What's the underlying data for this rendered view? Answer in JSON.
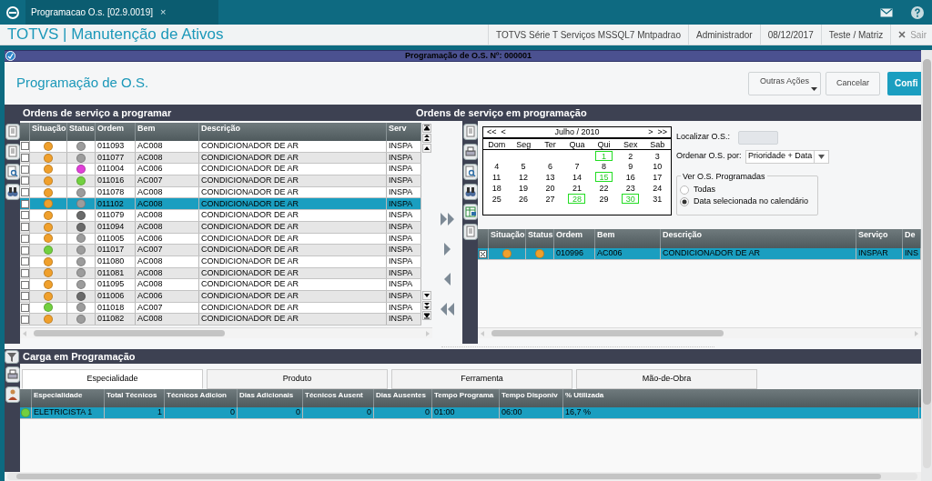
{
  "app_bar": {
    "tab": {
      "label": "Programacao O.s. [02.9.0019]",
      "close": "×"
    }
  },
  "header": {
    "title": "TOTVS | Manutenção de Ativos",
    "info": [
      "TOTVS Série T Serviços MSSQL7 Mntpadrao",
      "Administrador",
      "08/12/2017",
      "Teste / Matriz"
    ],
    "exit": "Sair"
  },
  "dialog_title": "Programação de O.S. Nº: 000001",
  "page_title": "Programação de O.S.",
  "actions": [
    {
      "label": "Outras Ações",
      "kind": "menu"
    },
    {
      "label": "Cancelar",
      "kind": "plain"
    },
    {
      "label": "Confi",
      "kind": "primary"
    }
  ],
  "left_panel": {
    "title": "Ordens de serviço a programar",
    "columns": [
      "Situação",
      "Status",
      "Ordem",
      "Bem",
      "Descrição",
      "Serv"
    ],
    "rows": [
      {
        "checked": false,
        "selected": false,
        "situacao": {
          "color": "#f0a02c"
        },
        "status": {
          "color": "#9c9c9c"
        },
        "ordem": "011093",
        "bem": "AC008",
        "descricao": "CONDICIONADOR DE AR",
        "servico": "INSPA"
      },
      {
        "checked": false,
        "selected": false,
        "situacao": {
          "color": "#f0a02c"
        },
        "status": {
          "color": "#9c9c9c"
        },
        "ordem": "011077",
        "bem": "AC008",
        "descricao": "CONDICIONADOR DE AR",
        "servico": "INSPA"
      },
      {
        "checked": false,
        "selected": false,
        "situacao": {
          "color": "#f0a02c"
        },
        "status": {
          "color": "#e040d8"
        },
        "ordem": "011004",
        "bem": "AC006",
        "descricao": "CONDICIONADOR DE AR",
        "servico": "INSPA"
      },
      {
        "checked": false,
        "selected": false,
        "situacao": {
          "color": "#f0a02c"
        },
        "status": {
          "color": "#72d040"
        },
        "ordem": "011016",
        "bem": "AC007",
        "descricao": "CONDICIONADOR DE AR",
        "servico": "INSPA"
      },
      {
        "checked": false,
        "selected": false,
        "situacao": {
          "color": "#f0a02c"
        },
        "status": {
          "color": "#9c9c9c"
        },
        "ordem": "011078",
        "bem": "AC008",
        "descricao": "CONDICIONADOR DE AR",
        "servico": "INSPA"
      },
      {
        "checked": false,
        "selected": true,
        "situacao": {
          "color": "#f0a02c"
        },
        "status": {
          "color": "#9c9c9c"
        },
        "ordem": "011102",
        "bem": "AC008",
        "descricao": "CONDICIONADOR DE AR",
        "servico": "INSPA"
      },
      {
        "checked": false,
        "selected": false,
        "situacao": {
          "color": "#f0a02c"
        },
        "status": {
          "color": "#6a6a6a"
        },
        "ordem": "011079",
        "bem": "AC008",
        "descricao": "CONDICIONADOR DE AR",
        "servico": "INSPA"
      },
      {
        "checked": false,
        "selected": false,
        "situacao": {
          "color": "#f0a02c"
        },
        "status": {
          "color": "#6a6a6a"
        },
        "ordem": "011094",
        "bem": "AC008",
        "descricao": "CONDICIONADOR DE AR",
        "servico": "INSPA"
      },
      {
        "checked": false,
        "selected": false,
        "situacao": {
          "color": "#f0a02c"
        },
        "status": {
          "color": "#9c9c9c"
        },
        "ordem": "011005",
        "bem": "AC006",
        "descricao": "CONDICIONADOR DE AR",
        "servico": "INSPA"
      },
      {
        "checked": false,
        "selected": false,
        "situacao": {
          "color": "#72d040"
        },
        "status": {
          "color": "#9c9c9c"
        },
        "ordem": "011017",
        "bem": "AC007",
        "descricao": "CONDICIONADOR DE AR",
        "servico": "INSPA"
      },
      {
        "checked": false,
        "selected": false,
        "situacao": {
          "color": "#f0a02c"
        },
        "status": {
          "color": "#9c9c9c"
        },
        "ordem": "011080",
        "bem": "AC008",
        "descricao": "CONDICIONADOR DE AR",
        "servico": "INSPA"
      },
      {
        "checked": false,
        "selected": false,
        "situacao": {
          "color": "#f0a02c"
        },
        "status": {
          "color": "#9c9c9c"
        },
        "ordem": "011081",
        "bem": "AC008",
        "descricao": "CONDICIONADOR DE AR",
        "servico": "INSPA"
      },
      {
        "checked": false,
        "selected": false,
        "situacao": {
          "color": "#f0a02c"
        },
        "status": {
          "color": "#9c9c9c"
        },
        "ordem": "011095",
        "bem": "AC008",
        "descricao": "CONDICIONADOR DE AR",
        "servico": "INSPA"
      },
      {
        "checked": false,
        "selected": false,
        "situacao": {
          "color": "#f0a02c"
        },
        "status": {
          "color": "#6a6a6a"
        },
        "ordem": "011006",
        "bem": "AC006",
        "descricao": "CONDICIONADOR DE AR",
        "servico": "INSPA"
      },
      {
        "checked": false,
        "selected": false,
        "situacao": {
          "color": "#72d040"
        },
        "status": {
          "color": "#9c9c9c"
        },
        "ordem": "011018",
        "bem": "AC007",
        "descricao": "CONDICIONADOR DE AR",
        "servico": "INSPA"
      },
      {
        "checked": false,
        "selected": false,
        "situacao": {
          "color": "#f0a02c"
        },
        "status": {
          "color": "#9c9c9c"
        },
        "ordem": "011082",
        "bem": "AC008",
        "descricao": "CONDICIONADOR DE AR",
        "servico": "INSPA"
      }
    ]
  },
  "right_panel": {
    "title": "Ordens de serviço em programação",
    "calendar": {
      "prev_year": "<<",
      "prev_month": "<",
      "month": "Julho / 2010",
      "next_month": ">",
      "next_year": ">>",
      "weekdays": [
        "Dom",
        "Seg",
        "Ter",
        "Qua",
        "Qui",
        "Sex",
        "Sab"
      ],
      "weeks": [
        [
          {
            "day": "1",
            "marked": true
          },
          {
            "day": "2",
            "marked": false
          },
          {
            "day": "3",
            "marked": false
          }
        ],
        [
          {
            "day": "4",
            "marked": false
          },
          {
            "day": "5",
            "marked": false
          },
          {
            "day": "6",
            "marked": false
          },
          {
            "day": "7",
            "marked": false
          },
          {
            "day": "8",
            "marked": false
          },
          {
            "day": "9",
            "marked": false
          },
          {
            "day": "10",
            "marked": false
          }
        ],
        [
          {
            "day": "11",
            "marked": false
          },
          {
            "day": "12",
            "marked": false
          },
          {
            "day": "13",
            "marked": false
          },
          {
            "day": "14",
            "marked": false
          },
          {
            "day": "15",
            "marked": true
          },
          {
            "day": "16",
            "marked": false
          },
          {
            "day": "17",
            "marked": false
          }
        ],
        [
          {
            "day": "18",
            "marked": false
          },
          {
            "day": "19",
            "marked": false
          },
          {
            "day": "20",
            "marked": false
          },
          {
            "day": "21",
            "marked": false
          },
          {
            "day": "22",
            "marked": false
          },
          {
            "day": "23",
            "marked": false
          },
          {
            "day": "24",
            "marked": false
          }
        ],
        [
          {
            "day": "25",
            "marked": false
          },
          {
            "day": "26",
            "marked": false
          },
          {
            "day": "27",
            "marked": false
          },
          {
            "day": "28",
            "marked": true
          },
          {
            "day": "29",
            "marked": false
          },
          {
            "day": "30",
            "marked": true
          },
          {
            "day": "31",
            "marked": false
          }
        ]
      ]
    },
    "locate_label": "Localizar O.S.:",
    "order_label": "Ordenar O.S. por:",
    "order_value": "Prioridade + Data",
    "view_group": {
      "legend": "Ver O.S. Programadas",
      "options": [
        {
          "label": "Todas",
          "selected": false
        },
        {
          "label": "Data selecionada no calendário",
          "selected": true
        }
      ]
    },
    "columns": [
      "Situação",
      "Status",
      "Ordem",
      "Bem",
      "Descrição",
      "Serviço",
      "De"
    ],
    "rows": [
      {
        "checked": true,
        "selected": true,
        "situacao": {
          "color": "#f0a02c"
        },
        "status": {
          "color": "#f0a02c"
        },
        "ordem": "010996",
        "bem": "AC006",
        "descricao": "CONDICIONADOR DE AR",
        "servico": "INSPAR",
        "column_7": "INS"
      }
    ]
  },
  "load_panel": {
    "title": "Carga em Programação",
    "tabs": [
      {
        "label": "Especialidade",
        "selected": true
      },
      {
        "label": "Produto",
        "selected": false
      },
      {
        "label": "Ferramenta",
        "selected": false
      },
      {
        "label": "Mão-de-Obra",
        "selected": false
      }
    ],
    "columns": [
      "Especialidade",
      "Total Técnicos",
      "Técnicos Adicion",
      "Dias Adicionais",
      "Técnicos Ausent",
      "Dias Ausentes",
      "Tempo Programa",
      "Tempo Disponiv",
      "% Utilizada"
    ],
    "rows": [
      {
        "selected": true,
        "color": "#72d040",
        "cells": [
          "ELETRICISTA 1",
          "1",
          "0",
          "0",
          "0",
          "0",
          "01:00",
          "06:00",
          "16,7 %"
        ]
      }
    ]
  }
}
